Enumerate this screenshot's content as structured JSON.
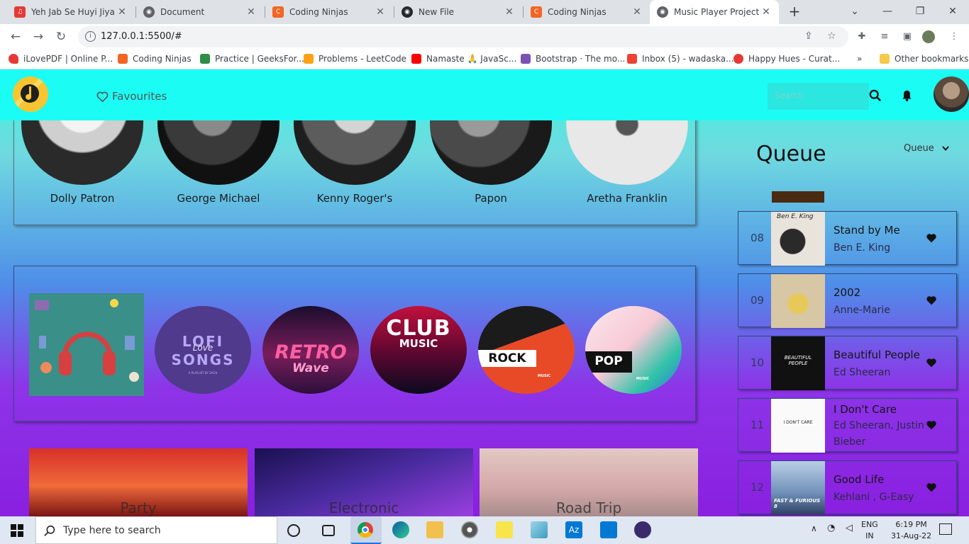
{
  "browser": {
    "tabs": [
      {
        "title": "Yeh Jab Se Huyi Jiya K",
        "color": "#e53935",
        "glyph": "♫"
      },
      {
        "title": "Document",
        "color": "#5f6368",
        "glyph": "◉"
      },
      {
        "title": "Coding Ninjas",
        "color": "#f26522",
        "glyph": "C"
      },
      {
        "title": "New File",
        "color": "#24292e",
        "glyph": "◉"
      },
      {
        "title": "Coding Ninjas",
        "color": "#f26522",
        "glyph": "C"
      },
      {
        "title": "Music Player Project",
        "color": "#5f6368",
        "glyph": "◉"
      }
    ],
    "new_tab": "+",
    "address": "127.0.0.1:5500/#",
    "bookmarks": [
      {
        "label": "iLovePDF | Online P...",
        "color": "#e53935"
      },
      {
        "label": "Coding Ninjas",
        "color": "#f26522"
      },
      {
        "label": "Practice | GeeksFor...",
        "color": "#2f8d46"
      },
      {
        "label": "Problems - LeetCode",
        "color": "#ffa116"
      },
      {
        "label": "Namaste 🙏 JavaSc...",
        "color": "#ff0000"
      },
      {
        "label": "Bootstrap · The mo...",
        "color": "#7952b3"
      },
      {
        "label": "Inbox (5) - wadaska...",
        "color": "#ea4335"
      },
      {
        "label": "Happy Hues - Curat...",
        "color": "#e53935"
      }
    ],
    "more_bookmarks": "»",
    "other_bookmarks": "Other bookmarks"
  },
  "app": {
    "nav": {
      "favourites": "Favourites",
      "search_placeholder": "Search"
    },
    "artists": [
      "Dolly Patron",
      "George Michael",
      "Kenny Roger's",
      "Papon",
      "Aretha Franklin"
    ],
    "playlists": [
      {
        "label": "LOFI",
        "sub": "Love",
        "sub2": "SONGS",
        "note": "A PLAYLIST BY ZACH"
      },
      {
        "label": "RETRO",
        "sub": "Wave"
      },
      {
        "label": "CLUB",
        "sub": "MUSIC"
      },
      {
        "label": "ROCK",
        "sub": "MUSIC"
      },
      {
        "label": "POP",
        "sub": "MUSIC"
      }
    ],
    "genres": [
      "Party",
      "Electronic",
      "Road Trip"
    ],
    "queue": {
      "title": "Queue",
      "dropdown": "Queue",
      "items": [
        {
          "num": "08",
          "song": "Stand by Me",
          "artist": "Ben E. King",
          "art_text": "Ben E. King"
        },
        {
          "num": "09",
          "song": "2002",
          "artist": "Anne-Marie"
        },
        {
          "num": "10",
          "song": "Beautiful People",
          "artist": "Ed Sheeran",
          "art_text": "BEAUTIFUL PEOPLE"
        },
        {
          "num": "11",
          "song": "I Don't Care",
          "artist": "Ed Sheeran, Justin Bieber",
          "art_text": "I DON'T CARE"
        },
        {
          "num": "12",
          "song": "Good Life",
          "artist": "Kehlani , G-Easy",
          "art_text": "FAST & FURIOUS 8"
        }
      ]
    }
  },
  "taskbar": {
    "search_placeholder": "Type here to search",
    "lang": "ENG",
    "region": "IN",
    "time": "6:19 PM",
    "date": "31-Aug-22"
  }
}
